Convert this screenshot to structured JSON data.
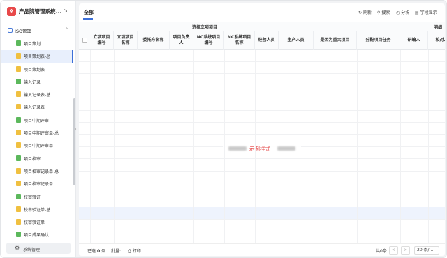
{
  "app": {
    "logo_glyph": "❖",
    "title": "产品院管理系统...",
    "collapse_icon": "↘"
  },
  "sidebar": {
    "section_label": "ISO管理",
    "items": [
      {
        "label": "项目策划",
        "color": "green",
        "active": false
      },
      {
        "label": "项目策划表-总",
        "color": "yellow",
        "active": true
      },
      {
        "label": "项目策划表",
        "color": "yellow",
        "active": false
      },
      {
        "label": "输入记录",
        "color": "green",
        "active": false
      },
      {
        "label": "输入记录表-总",
        "color": "yellow",
        "active": false
      },
      {
        "label": "输入记录表",
        "color": "yellow",
        "active": false
      },
      {
        "label": "项目中期评审",
        "color": "green",
        "active": false
      },
      {
        "label": "项目中期评审单-总",
        "color": "yellow",
        "active": false
      },
      {
        "label": "项目中期评审单",
        "color": "yellow",
        "active": false
      },
      {
        "label": "项目校审",
        "color": "green",
        "active": false
      },
      {
        "label": "项目校审记录单-总",
        "color": "yellow",
        "active": false
      },
      {
        "label": "项目校审记录单",
        "color": "yellow",
        "active": false
      },
      {
        "label": "校审验证",
        "color": "green",
        "active": false
      },
      {
        "label": "校审验证单-总",
        "color": "yellow",
        "active": false
      },
      {
        "label": "校审验证单",
        "color": "yellow",
        "active": false
      },
      {
        "label": "项目成果确认",
        "color": "green",
        "active": false
      }
    ],
    "footer_label": "系统管理"
  },
  "toolbar": {
    "tab_label": "全部",
    "refresh_label": "刷新",
    "search_label": "搜索",
    "analyze_label": "分析",
    "fields_label": "字段显示"
  },
  "table": {
    "group_headers": [
      "选择立项项目",
      "明细"
    ],
    "columns": [
      "立项项目编号",
      "立项项目名称",
      "委托方名称",
      "项目负责人",
      "NC系统项目编号",
      "NC系统项目名称",
      "经营人员",
      "生产人员",
      "是否为重大项目",
      "分配项目任务",
      "研编人",
      "校对人"
    ],
    "watermark": "示例样式"
  },
  "footer": {
    "selected_label": "已选",
    "selected_count": "0",
    "selected_unit": "条",
    "batch_label": "批量:",
    "print_label": "打印",
    "total_label": "共0条",
    "page_size": "20 条/...",
    "prev_glyph": "<",
    "next_glyph": ">"
  }
}
